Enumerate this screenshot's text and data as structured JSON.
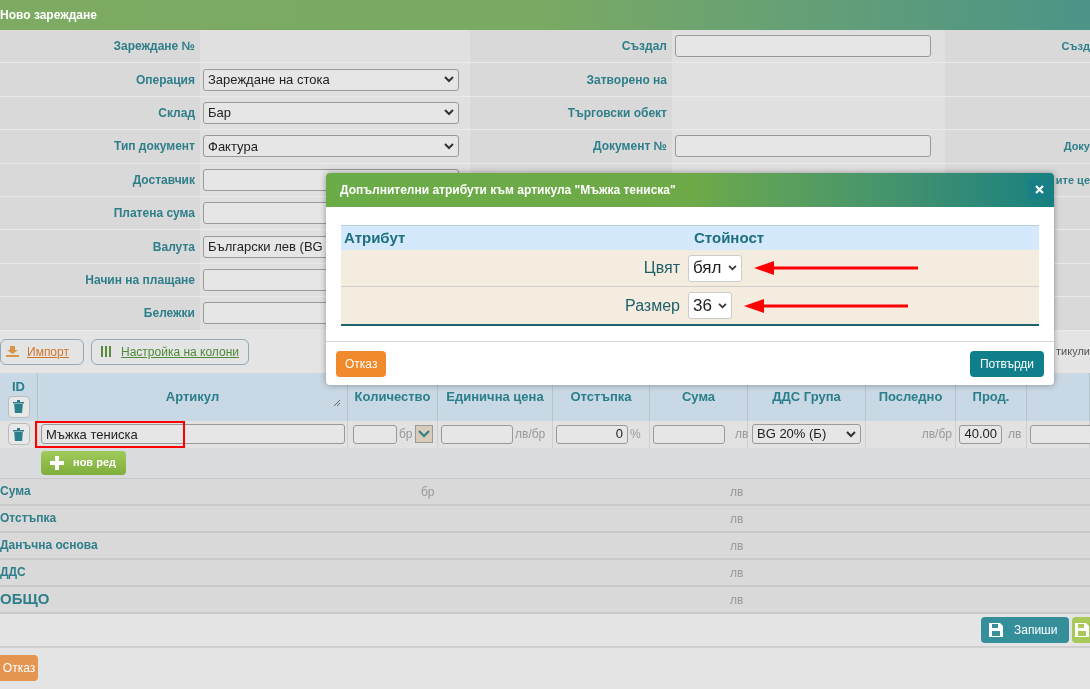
{
  "header": {
    "title": "Ново зареждане"
  },
  "form_rows": [
    {
      "cells": [
        {
          "label": "Зареждане №",
          "field": {
            "kind": "none"
          }
        },
        {
          "label": "Създал",
          "field": {
            "kind": "input"
          }
        },
        {
          "label": "Създ"
        }
      ]
    },
    {
      "cells": [
        {
          "label": "Операция",
          "field": {
            "kind": "select",
            "value": "Зареждане на стока"
          }
        },
        {
          "label": "Затворено на",
          "field": {
            "kind": "none"
          }
        },
        {}
      ]
    },
    {
      "cells": [
        {
          "label": "Склад",
          "field": {
            "kind": "select",
            "value": "Бар"
          }
        },
        {
          "label": "Търговски обект",
          "field": {
            "kind": "none"
          }
        },
        {}
      ]
    },
    {
      "cells": [
        {
          "label": "Тип документ",
          "field": {
            "kind": "select",
            "value": "Фактура"
          }
        },
        {
          "label": "Документ №",
          "field": {
            "kind": "input"
          }
        },
        {
          "label": "Доку"
        }
      ]
    },
    {
      "cells": [
        {
          "label": "Доставчик",
          "field": {
            "kind": "input"
          }
        },
        {
          "field": {
            "kind": "none"
          }
        },
        {
          "label": "ите це"
        }
      ]
    },
    {
      "cells": [
        {
          "label": "Платена сума",
          "field": {
            "kind": "input"
          }
        },
        {},
        {}
      ]
    },
    {
      "cells": [
        {
          "label": "Валута",
          "field": {
            "kind": "input",
            "value": "Български лев (BG"
          }
        },
        {},
        {}
      ]
    },
    {
      "cells": [
        {
          "label": "Начин на плащане",
          "field": {
            "kind": "input"
          }
        },
        {
          "field": {
            "kind": "none"
          }
        },
        {}
      ]
    },
    {
      "cells": [
        {
          "label": "Бележки",
          "field": {
            "kind": "input"
          }
        },
        {
          "field": {
            "kind": "none"
          }
        },
        {}
      ]
    }
  ],
  "toolbar": {
    "import": "Импорт",
    "columns": "Настройка на колони",
    "right_text": "тикули"
  },
  "table": {
    "columns": [
      "ID",
      "Артикул",
      "Количество",
      "Единична цена",
      "Отстъпка",
      "Сума",
      "ДДС Група",
      "Последно",
      "Прод.",
      ""
    ],
    "row": {
      "article": "Мъжка тениска",
      "highlighted": true,
      "qty_unit": "бр",
      "price_unit": "лв/бр",
      "discount": "0",
      "discount_unit": "%",
      "sum_unit": "лв",
      "vat": "BG 20% (Б)",
      "last_unit": "лв/бр",
      "prod": "40.00",
      "prod_unit": "лв"
    },
    "new_row": "нов ред"
  },
  "summary": [
    {
      "kind": "line",
      "label": "Сума",
      "qty_unit": "бр",
      "currency": "лв"
    },
    {
      "kind": "line",
      "label": "Отстъпка",
      "currency": "лв"
    },
    {
      "kind": "line",
      "label": "Данъчна основа",
      "currency": "лв"
    },
    {
      "kind": "line",
      "label": "ДДС",
      "currency": "лв"
    },
    {
      "kind": "total",
      "label": "ОБЩО",
      "currency": "лв"
    }
  ],
  "footer": {
    "save": "Запиши",
    "second_save": true,
    "cancel": "Отказ"
  },
  "modal": {
    "title": "Допълнителни атрибути към артикула \"Мъжка тениска\"",
    "columns": [
      "Атрибут",
      "Стойност"
    ],
    "rows": [
      {
        "label": "Цвят",
        "value": "бял",
        "arrow": true
      },
      {
        "label": "Размер",
        "value": "36",
        "arrow": true
      }
    ],
    "cancel": "Отказ",
    "confirm": "Потвърди"
  }
}
